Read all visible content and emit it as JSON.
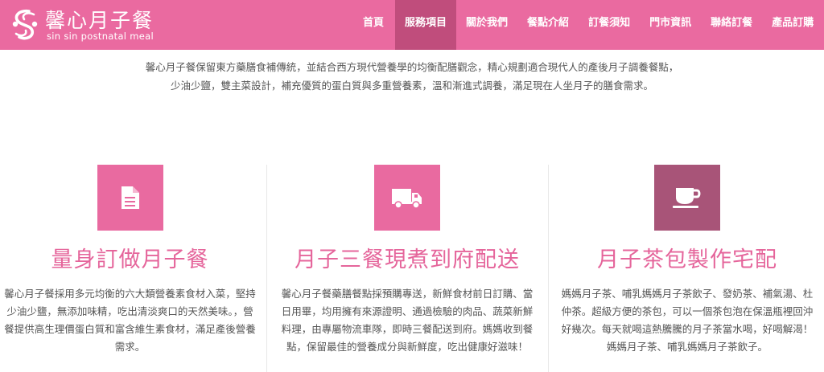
{
  "brand": {
    "name": "馨心月子餐",
    "tagline": "sin sin postnatal meal"
  },
  "nav": {
    "items": [
      {
        "label": "首頁"
      },
      {
        "label": "服務項目"
      },
      {
        "label": "關於我們"
      },
      {
        "label": "餐點介紹"
      },
      {
        "label": "訂餐須知"
      },
      {
        "label": "門市資訊"
      },
      {
        "label": "聯絡訂餐"
      },
      {
        "label": "產品訂購"
      }
    ],
    "active_index": 1
  },
  "intro": {
    "line1": "馨心月子餐保留東方藥膳食補傳統，並結合西方現代營養學的均衡配膳觀念，精心規劃適合現代人的產後月子調養餐點，",
    "line2": "少油少鹽，雙主菜設計，補充優質的蛋白質與多重營養素，溫和漸進式調養，滿足現在人坐月子的膳食需求。"
  },
  "services": [
    {
      "icon": "document-icon",
      "title": "量身訂做月子餐",
      "lines": [
        "馨心月子餐採用多元均衡的六大類營養素食材入菜，堅持",
        "少油少鹽，無添加味精，吃出清淡爽口的天然美味。，營",
        "餐提供高生理價蛋白質和富含維生素食材，滿足產後營養",
        "需求。"
      ]
    },
    {
      "icon": "truck-icon",
      "title": "月子三餐現煮到府配送",
      "lines": [
        "馨心月子餐藥膳餐點採預購專送，新鮮食材前日訂購、當",
        "日用畢，均用擁有來源證明、通過檢驗的肉品、蔬菜新鮮",
        "料理，由專屬物流車隊，即時三餐配送到府。媽媽收到餐",
        "點，保留最佳的營養成分與新鮮度，吃出健康好滋味！"
      ]
    },
    {
      "icon": "coffee-cup-icon",
      "title": "月子茶包製作宅配",
      "lines": [
        "媽媽月子茶、哺乳媽媽月子茶飲子、發奶茶、補氣湯、杜",
        "仲茶。超級方便的茶包，可以一個茶包泡在保溫瓶裡回沖",
        "好幾次。每天就喝這熱騰騰的月子茶當水喝，好喝解渴！",
        "媽媽月子茶、哺乳媽媽月子茶飲子。"
      ]
    }
  ],
  "colors": {
    "header_bg": "#ea6aa0",
    "nav_active_bg": "#c04d7c",
    "accent_pink": "#e96aa0",
    "accent_dark": "#a85478",
    "title_pink": "#e5659b"
  }
}
